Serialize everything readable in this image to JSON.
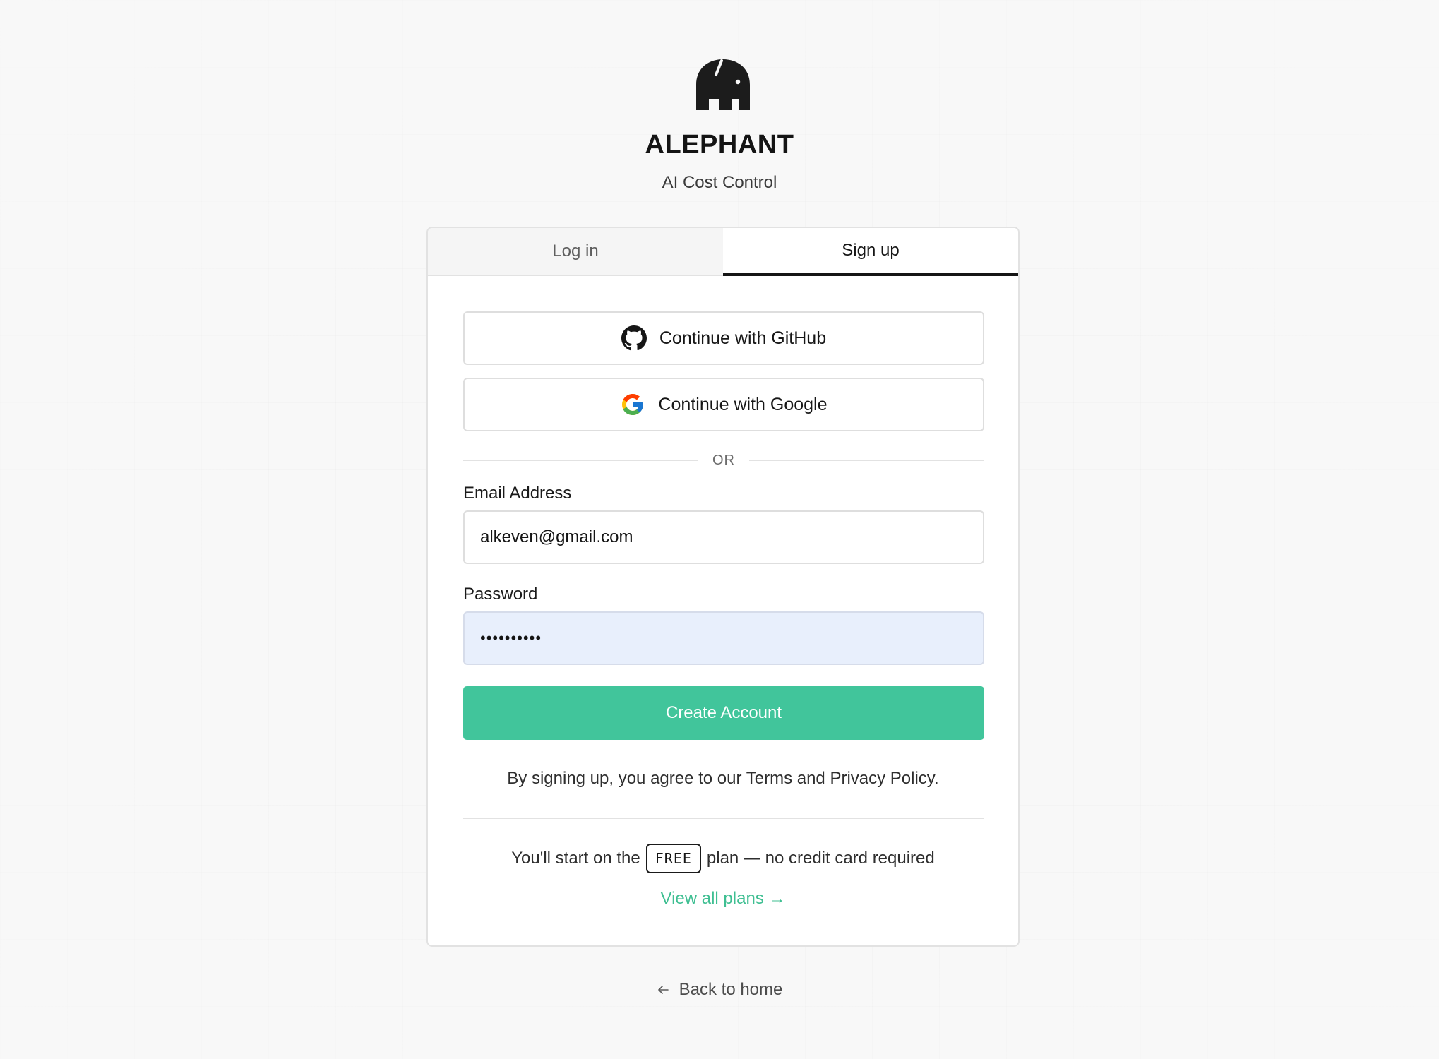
{
  "brand": {
    "name": "ALEPHANT",
    "tagline": "AI Cost Control",
    "logo_icon": "elephant-logo-icon"
  },
  "tabs": [
    {
      "label": "Log in",
      "active": false
    },
    {
      "label": "Sign up",
      "active": true
    }
  ],
  "oauth": {
    "github_label": "Continue with GitHub",
    "github_icon": "github-icon",
    "google_label": "Continue with Google",
    "google_icon": "google-icon"
  },
  "divider_text": "OR",
  "form": {
    "email_label": "Email Address",
    "email_value": "alkeven@gmail.com",
    "password_label": "Password",
    "password_value": "••••••••••",
    "submit_label": "Create Account"
  },
  "terms_text": "By signing up, you agree to our Terms and Privacy Policy.",
  "plan": {
    "prefix": "You'll start on the",
    "badge": "FREE",
    "suffix": "plan — no credit card required",
    "view_plans_label": "View all plans →"
  },
  "back_home": {
    "label": "Back to home",
    "icon": "arrow-left-icon"
  },
  "colors": {
    "accent": "#41c59b",
    "link": "#3fbf92",
    "autofill_bg": "#e8effc"
  }
}
